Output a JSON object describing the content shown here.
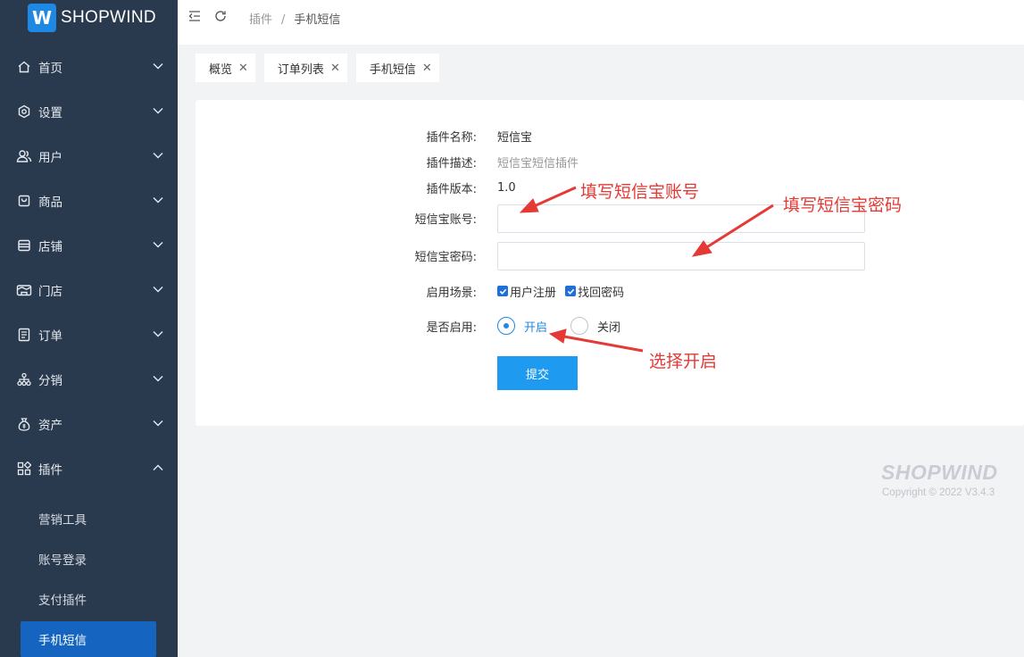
{
  "brand": {
    "logo_letter": "W",
    "name": "SHOPWIND",
    "accent": "#1e88e5"
  },
  "sidebar": {
    "items": [
      {
        "label": "首页",
        "icon": "home-icon"
      },
      {
        "label": "设置",
        "icon": "gear-icon"
      },
      {
        "label": "用户",
        "icon": "users-icon"
      },
      {
        "label": "商品",
        "icon": "bag-icon"
      },
      {
        "label": "店铺",
        "icon": "store-icon"
      },
      {
        "label": "门店",
        "icon": "shop-icon"
      },
      {
        "label": "订单",
        "icon": "document-icon"
      },
      {
        "label": "分销",
        "icon": "network-icon"
      },
      {
        "label": "资产",
        "icon": "money-bag-icon"
      },
      {
        "label": "插件",
        "icon": "grid-icon"
      }
    ],
    "sub_items": [
      "营销工具",
      "账号登录",
      "支付插件",
      "手机短信"
    ],
    "active_sub": "手机短信"
  },
  "breadcrumb": {
    "parent": "插件",
    "separator": "/",
    "current": "手机短信"
  },
  "tabs": [
    {
      "label": "概览"
    },
    {
      "label": "订单列表"
    },
    {
      "label": "手机短信"
    }
  ],
  "form": {
    "name_label": "插件名称:",
    "name_value": "短信宝",
    "desc_label": "插件描述:",
    "desc_value": "短信宝短信插件",
    "version_label": "插件版本:",
    "version_value": "1.0",
    "account_label": "短信宝账号:",
    "account_value": "",
    "password_label": "短信宝密码:",
    "password_value": "",
    "scene_label": "启用场景:",
    "scene_options": [
      "用户注册",
      "找回密码"
    ],
    "enable_label": "是否启用:",
    "enable_on": "开启",
    "enable_off": "关闭",
    "submit_label": "提交"
  },
  "annotations": {
    "account": "填写短信宝账号",
    "password": "填写短信宝密码",
    "enable": "选择开启",
    "color": "#e53935"
  },
  "footer": {
    "logo": "SHOPWIND",
    "copyright": "Copyright © 2022 V3.4.3"
  }
}
